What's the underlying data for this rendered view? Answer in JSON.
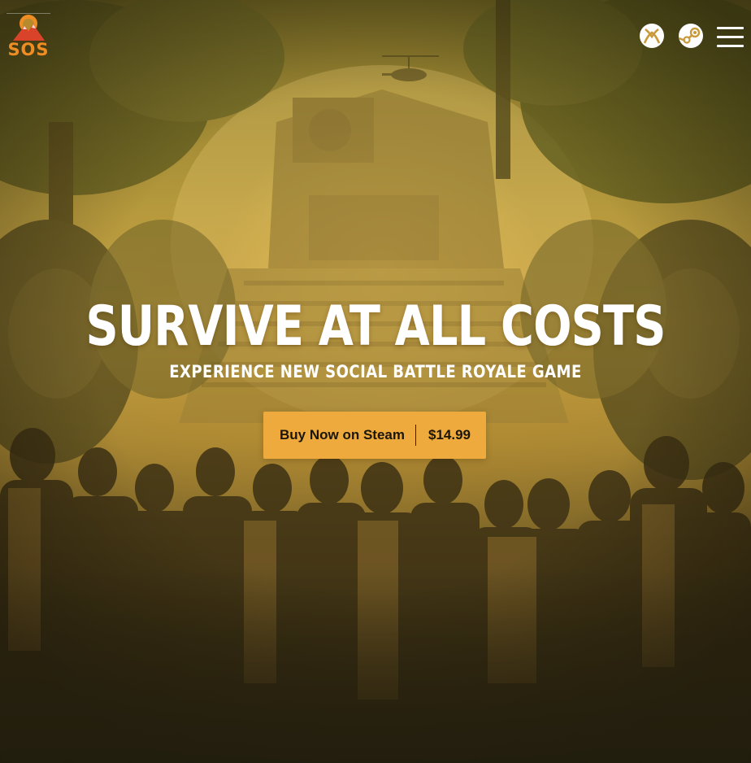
{
  "brand": {
    "logo_text": "SOS",
    "logo_color": "#ee8d24",
    "logo_accent": "#d9432a"
  },
  "header": {
    "icons": [
      "xbox-icon",
      "steam-icon",
      "hamburger-menu-icon"
    ]
  },
  "hero": {
    "title": "SURVIVE AT ALL COSTS",
    "subtitle": "EXPERIENCE NEW SOCIAL BATTLE ROYALE GAME"
  },
  "cta": {
    "label": "Buy Now on Steam",
    "price": "$14.99",
    "color": "#eeaa3c"
  },
  "background": {
    "scene": "jungle-temple-with-survivors",
    "tint": "#c7a243"
  }
}
